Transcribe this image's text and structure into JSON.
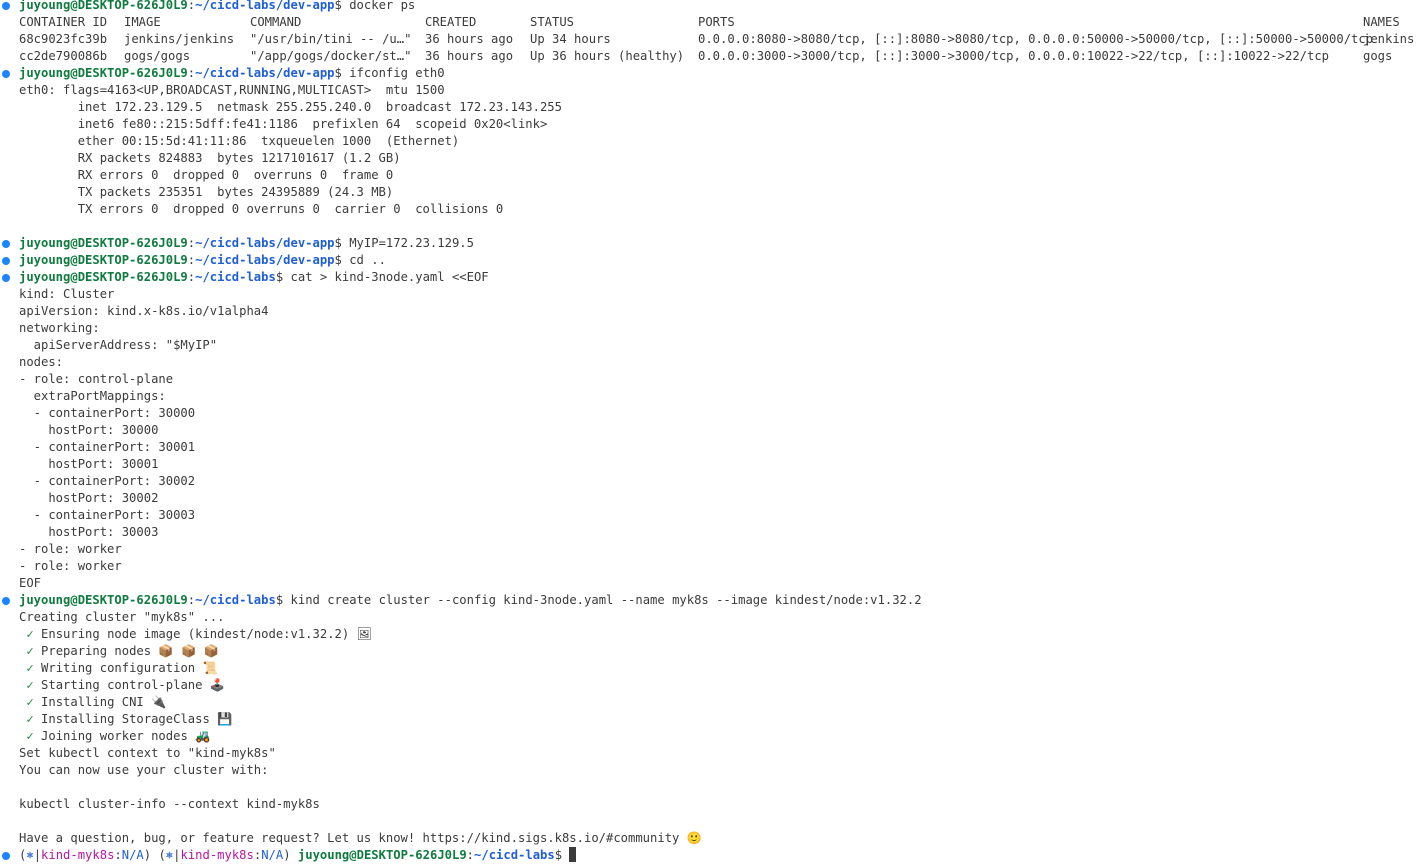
{
  "prompt": {
    "user_host": "juyoung@DESKTOP-626J0L9",
    "sep": ":",
    "dollar": "$ "
  },
  "docker": {
    "headers": [
      "CONTAINER ID",
      "IMAGE",
      "COMMAND",
      "CREATED",
      "STATUS",
      "PORTS",
      "NAMES"
    ],
    "rows": [
      [
        "68c9023fc39b",
        "jenkins/jenkins",
        "\"/usr/bin/tini -- /u…\"",
        "36 hours ago",
        "Up 34 hours",
        "0.0.0.0:8080->8080/tcp, [::]:8080->8080/tcp, 0.0.0.0:50000->50000/tcp, [::]:50000->50000/tcp",
        "jenkins"
      ],
      [
        "cc2de790086b",
        "gogs/gogs",
        "\"/app/gogs/docker/st…\"",
        "36 hours ago",
        "Up 36 hours (healthy)",
        "0.0.0.0:3000->3000/tcp, [::]:3000->3000/tcp, 0.0.0.0:10022->22/tcp, [::]:10022->22/tcp",
        "gogs"
      ]
    ]
  },
  "lines": [
    {
      "type": "prompt",
      "path": "~/cicd-labs/dev-app",
      "cmd": "docker ps"
    },
    {
      "type": "dockerhead"
    },
    {
      "type": "dockerrow",
      "row": 0
    },
    {
      "type": "dockerrow",
      "row": 1
    },
    {
      "type": "prompt",
      "path": "~/cicd-labs/dev-app",
      "cmd": "ifconfig eth0"
    },
    {
      "type": "text",
      "text": "eth0: flags=4163<UP,BROADCAST,RUNNING,MULTICAST>  mtu 1500"
    },
    {
      "type": "text",
      "text": "        inet 172.23.129.5  netmask 255.255.240.0  broadcast 172.23.143.255"
    },
    {
      "type": "text",
      "text": "        inet6 fe80::215:5dff:fe41:1186  prefixlen 64  scopeid 0x20<link>"
    },
    {
      "type": "text",
      "text": "        ether 00:15:5d:41:11:86  txqueuelen 1000  (Ethernet)"
    },
    {
      "type": "text",
      "text": "        RX packets 824883  bytes 1217101617 (1.2 GB)"
    },
    {
      "type": "text",
      "text": "        RX errors 0  dropped 0  overruns 0  frame 0"
    },
    {
      "type": "text",
      "text": "        TX packets 235351  bytes 24395889 (24.3 MB)"
    },
    {
      "type": "text",
      "text": "        TX errors 0  dropped 0 overruns 0  carrier 0  collisions 0"
    },
    {
      "type": "text",
      "text": ""
    },
    {
      "type": "prompt",
      "path": "~/cicd-labs/dev-app",
      "cmd": "MyIP=172.23.129.5"
    },
    {
      "type": "prompt",
      "path": "~/cicd-labs/dev-app",
      "cmd": "cd .."
    },
    {
      "type": "prompt",
      "path": "~/cicd-labs",
      "cmd": "cat > kind-3node.yaml <<EOF"
    },
    {
      "type": "text",
      "text": "kind: Cluster"
    },
    {
      "type": "text",
      "text": "apiVersion: kind.x-k8s.io/v1alpha4"
    },
    {
      "type": "text",
      "text": "networking:"
    },
    {
      "type": "text",
      "text": "  apiServerAddress: \"$MyIP\""
    },
    {
      "type": "text",
      "text": "nodes:"
    },
    {
      "type": "text",
      "text": "- role: control-plane"
    },
    {
      "type": "text",
      "text": "  extraPortMappings:"
    },
    {
      "type": "text",
      "text": "  - containerPort: 30000"
    },
    {
      "type": "text",
      "text": "    hostPort: 30000"
    },
    {
      "type": "text",
      "text": "  - containerPort: 30001"
    },
    {
      "type": "text",
      "text": "    hostPort: 30001"
    },
    {
      "type": "text",
      "text": "  - containerPort: 30002"
    },
    {
      "type": "text",
      "text": "    hostPort: 30002"
    },
    {
      "type": "text",
      "text": "  - containerPort: 30003"
    },
    {
      "type": "text",
      "text": "    hostPort: 30003"
    },
    {
      "type": "text",
      "text": "- role: worker"
    },
    {
      "type": "text",
      "text": "- role: worker"
    },
    {
      "type": "text",
      "text": "EOF"
    },
    {
      "type": "prompt",
      "path": "~/cicd-labs",
      "cmd": "kind create cluster --config kind-3node.yaml --name myk8s --image kindest/node:v1.32.2"
    },
    {
      "type": "text",
      "text": "Creating cluster \"myk8s\" ..."
    },
    {
      "type": "check",
      "text": "Ensuring node image (kindest/node:v1.32.2) 🖼"
    },
    {
      "type": "check",
      "text": "Preparing nodes 📦 📦 📦"
    },
    {
      "type": "check",
      "text": "Writing configuration 📜"
    },
    {
      "type": "check",
      "text": "Starting control-plane 🕹️"
    },
    {
      "type": "check",
      "text": "Installing CNI 🔌"
    },
    {
      "type": "check",
      "text": "Installing StorageClass 💾"
    },
    {
      "type": "check",
      "text": "Joining worker nodes 🚜"
    },
    {
      "type": "text",
      "text": "Set kubectl context to \"kind-myk8s\""
    },
    {
      "type": "text",
      "text": "You can now use your cluster with:"
    },
    {
      "type": "text",
      "text": ""
    },
    {
      "type": "text",
      "text": "kubectl cluster-info --context kind-myk8s"
    },
    {
      "type": "text",
      "text": ""
    },
    {
      "type": "text",
      "text": "Have a question, bug, or feature request? Let us know! https://kind.sigs.k8s.io/#community 🙂"
    },
    {
      "type": "final",
      "kube_ctx": "kind-myk8s",
      "kube_ns": "N/A",
      "path": "~/cicd-labs"
    }
  ],
  "check_mark": "✓",
  "kube_icon": "⎈",
  "colors": {
    "bullet": "#1a85ff",
    "user": "#0f7b3f",
    "path": "#1f5fd6",
    "kube": "#b5179e",
    "check": "#0f8a3c",
    "text": "#3b3b3b"
  }
}
